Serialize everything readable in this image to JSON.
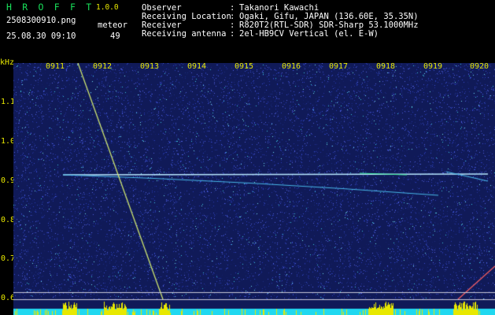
{
  "app": {
    "title": "H R O F F T",
    "version": "1.0.0",
    "file": "2508300910.png",
    "datetime": "25.08.30 09:10",
    "meteor_label": "meteor",
    "meteor_count": "49"
  },
  "info": [
    {
      "key": "Observer",
      "value": "Takanori Kawachi"
    },
    {
      "key": "Receiving Location",
      "value": "Ogaki, Gifu, JAPAN (136.60E, 35.35N)"
    },
    {
      "key": "Receiver",
      "value": "R820T2(RTL-SDR) SDR-Sharp 53.1000MHz"
    },
    {
      "key": "Receiving antenna",
      "value": "2el-HB9CV Vertical (el. E-W)"
    }
  ],
  "y_axis": {
    "unit": "kHz",
    "ticks": [
      "1.1",
      "1.0",
      "0.9",
      "0.8",
      "0.7",
      "0.6"
    ]
  },
  "time_axis": [
    "0911",
    "0912",
    "0913",
    "0914",
    "0915",
    "0916",
    "0917",
    "0918",
    "0919",
    "0920"
  ],
  "colors": {
    "background": "#000000",
    "waterfall": "#101a58",
    "text_white": "#ffffff",
    "text_yellow": "#e8e800",
    "title_green": "#18e05a",
    "meteor_trace": "#b8e8ff",
    "baseline_bars": "#e8e800",
    "floor": "#20d8f0"
  }
}
